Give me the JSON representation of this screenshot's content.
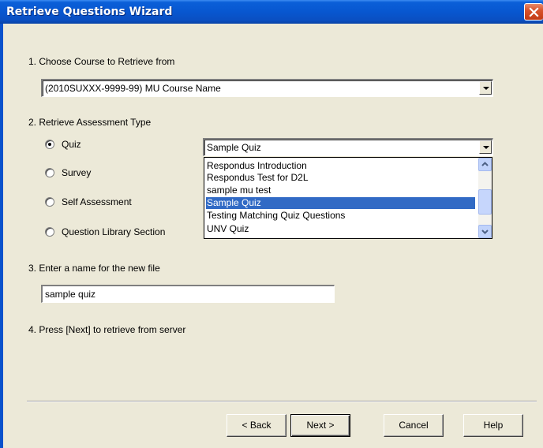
{
  "window": {
    "title": "Retrieve Questions Wizard"
  },
  "step1": {
    "label": "1.  Choose Course to Retrieve from",
    "course_value": "(2010SUXXX-9999-99) MU Course Name"
  },
  "step2": {
    "label": "2.  Retrieve Assessment Type",
    "options": [
      {
        "label": "Quiz",
        "checked": true
      },
      {
        "label": "Survey",
        "checked": false
      },
      {
        "label": "Self Assessment",
        "checked": false
      },
      {
        "label": "Question Library Section",
        "checked": false
      }
    ],
    "assessment_value": "Sample Quiz",
    "dropdown_items": [
      {
        "label": "Respondus Introduction",
        "selected": false
      },
      {
        "label": "Respondus Test for D2L",
        "selected": false
      },
      {
        "label": "sample mu test",
        "selected": false
      },
      {
        "label": "Sample Quiz",
        "selected": true
      },
      {
        "label": "Testing Matching Quiz Questions",
        "selected": false
      },
      {
        "label": "UNV Quiz",
        "selected": false
      }
    ]
  },
  "step3": {
    "label": "3.  Enter a name for the new file",
    "file_name_value": "sample quiz"
  },
  "step4": {
    "label": "4.  Press [Next] to retrieve from server"
  },
  "buttons": {
    "back": "< Back",
    "next": "Next >",
    "cancel": "Cancel",
    "help": "Help"
  },
  "colors": {
    "titlebar": "#0a5fd8",
    "selection": "#316ac5",
    "dialog_bg": "#ece9d8"
  }
}
